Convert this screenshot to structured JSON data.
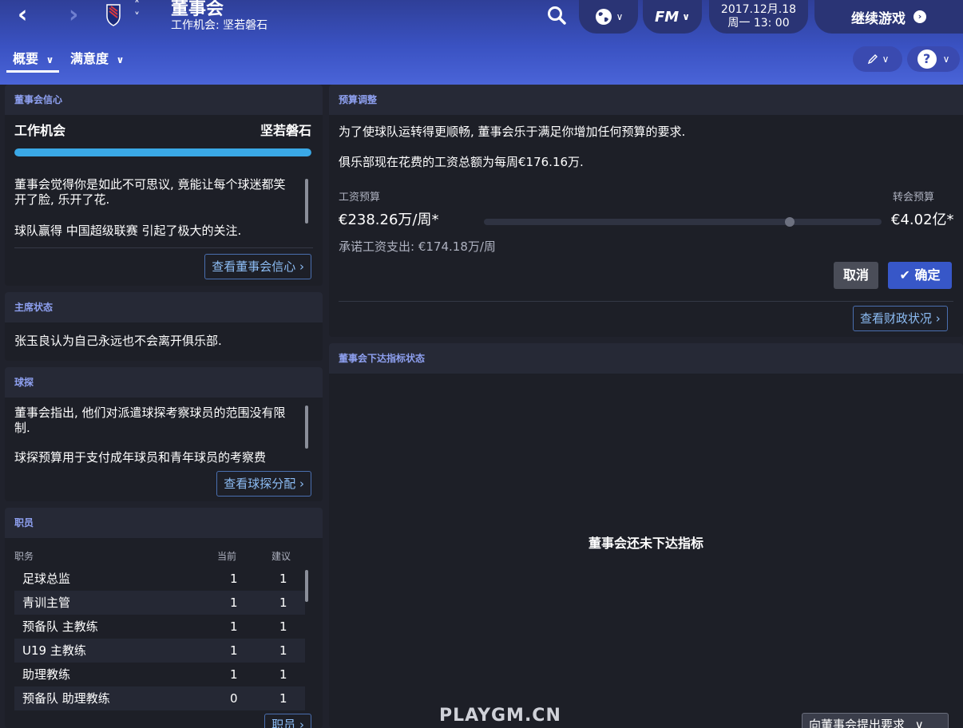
{
  "header": {
    "title": "董事会",
    "subtitle": "工作机会: 坚若磐石",
    "date": "2017.12月.18",
    "time": "周一 13: 00",
    "continue_label": "继续游戏",
    "fm_label": "FM"
  },
  "tabs": [
    {
      "label": "概要"
    },
    {
      "label": "满意度"
    }
  ],
  "board_confidence": {
    "title": "董事会信心",
    "label_left": "工作机会",
    "label_right": "坚若磐石",
    "level_percent": 100,
    "text1": "董事会觉得你是如此不可思议, 竟能让每个球迷都笑开了脸, 乐开了花.",
    "text2": "球队赢得 中国超级联赛 引起了极大的关注.",
    "button": "查看董事会信心"
  },
  "chairman": {
    "title": "主席状态",
    "text": "张玉良认为自己永远也不会离开俱乐部."
  },
  "scouting": {
    "title": "球探",
    "text1": "董事会指出, 他们对派遣球探考察球员的范围没有限制.",
    "text2": "球探预算用于支付成年球员和青年球员的考察费",
    "button": "查看球探分配"
  },
  "staff": {
    "title": "职员",
    "col_role": "职务",
    "col_current": "当前",
    "col_recommended": "建议",
    "rows": [
      {
        "role": "足球总监",
        "current": "1",
        "recommended": "1"
      },
      {
        "role": "青训主管",
        "current": "1",
        "recommended": "1"
      },
      {
        "role": "预备队 主教练",
        "current": "1",
        "recommended": "1"
      },
      {
        "role": "U19 主教练",
        "current": "1",
        "recommended": "1"
      },
      {
        "role": "助理教练",
        "current": "1",
        "recommended": "1"
      },
      {
        "role": "预备队 助理教练",
        "current": "0",
        "recommended": "1"
      }
    ],
    "button": "职员"
  },
  "budget": {
    "title": "预算调整",
    "text1": "为了使球队运转得更顺畅, 董事会乐于满足你增加任何预算的要求.",
    "text2": "俱乐部现在花费的工资总额为每周€176.16万.",
    "wage_label": "工资预算",
    "transfer_label": "转会预算",
    "wage_value": "€238.26万/周*",
    "transfer_value": "€4.02亿*",
    "slider_position_percent": 77,
    "committed_label": "承诺工资支出: ",
    "committed_value": "€174.18万/周",
    "cancel": "取消",
    "confirm": "确定",
    "finance_button": "查看财政状况"
  },
  "objectives": {
    "title": "董事会下达指标状态",
    "empty_text": "董事会还未下达指标",
    "request_button": "向董事会提出要求"
  },
  "watermark": "PLAYGM.CN",
  "colors": {
    "accent": "#3757c8",
    "progress": "#3aa8e6",
    "link": "#8dbdf5",
    "panel_title": "#8ea0f0"
  }
}
